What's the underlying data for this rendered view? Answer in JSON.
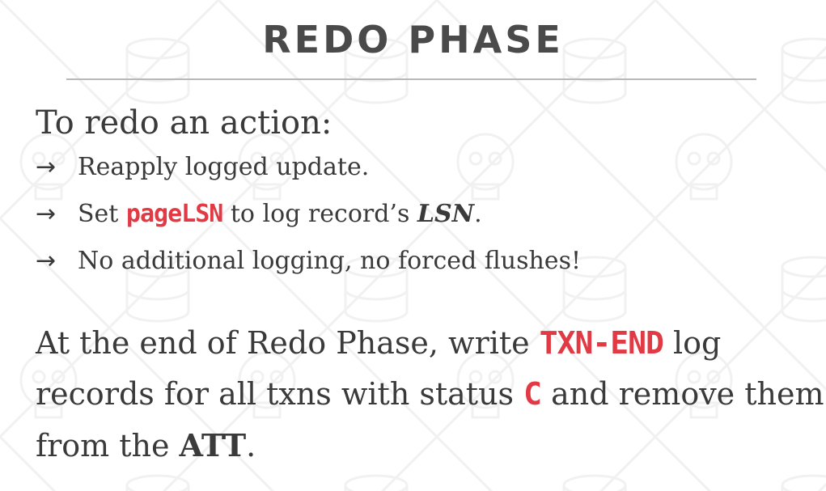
{
  "slide": {
    "title": "REDO PHASE",
    "lead": "To redo an action:",
    "bullets": [
      {
        "arrow": "→",
        "text": "Reapply logged update."
      },
      {
        "arrow": "→",
        "pre": "Set ",
        "code": "pageLSN",
        "mid": " to log record’s ",
        "emph": "LSN",
        "post": "."
      },
      {
        "arrow": "→",
        "text": "No additional logging, no forced flushes!"
      }
    ],
    "paragraph": {
      "p1": "At the end of Redo Phase, write ",
      "code1": "TXN-END",
      "p2": " log",
      "p3": "records for all txns with status ",
      "code2": "C",
      "p4": " and remove them",
      "p5": "from the ",
      "bold": "ATT",
      "p6": "."
    },
    "colors": {
      "code_highlight": "#e23a45",
      "title": "#4a4a4a",
      "body_text": "#3a3a3a",
      "rule": "#b8b8b8"
    }
  }
}
